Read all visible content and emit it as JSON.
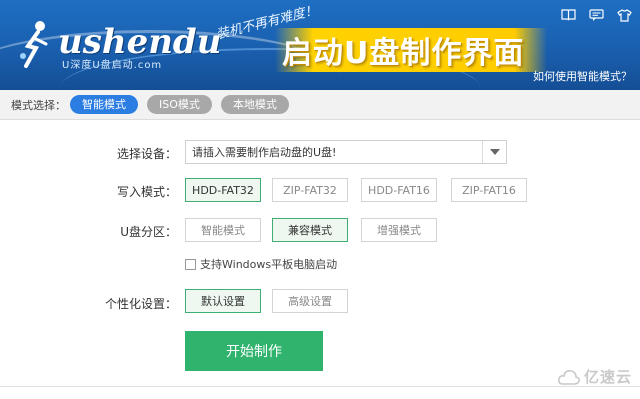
{
  "header": {
    "logo_text": "ushendu",
    "logo_sub": "U深度U盘启动.com",
    "slogan": "装机不再有难度！",
    "title": "启动U盘制作界面",
    "help_link": "如何使用智能模式？",
    "window_icons": [
      "book-icon",
      "message-icon",
      "shirt-icon"
    ]
  },
  "mode_bar": {
    "label": "模式选择：",
    "modes": [
      {
        "label": "智能模式",
        "active": true
      },
      {
        "label": "ISO模式",
        "active": false
      },
      {
        "label": "本地模式",
        "active": false
      }
    ]
  },
  "form": {
    "device": {
      "label": "选择设备：",
      "value": "请插入需要制作启动盘的U盘!"
    },
    "write_mode": {
      "label": "写入模式：",
      "options": [
        "HDD-FAT32",
        "ZIP-FAT32",
        "HDD-FAT16",
        "ZIP-FAT16"
      ],
      "selected": "HDD-FAT32"
    },
    "partition": {
      "label": "U盘分区：",
      "options": [
        "智能模式",
        "兼容模式",
        "增强模式"
      ],
      "selected": "兼容模式"
    },
    "windows_tablet": {
      "label": "支持Windows平板电脑启动",
      "checked": false
    },
    "personalize": {
      "label": "个性化设置：",
      "options": [
        "默认设置",
        "高级设置"
      ],
      "selected": "默认设置"
    },
    "start_button": "开始制作"
  },
  "watermark": "亿速云",
  "colors": {
    "header_blue": "#1a5fae",
    "accent_yellow": "#ffcc00",
    "active_blue": "#2b7de1",
    "selected_green": "#3fae74",
    "start_green": "#2fb36d"
  }
}
